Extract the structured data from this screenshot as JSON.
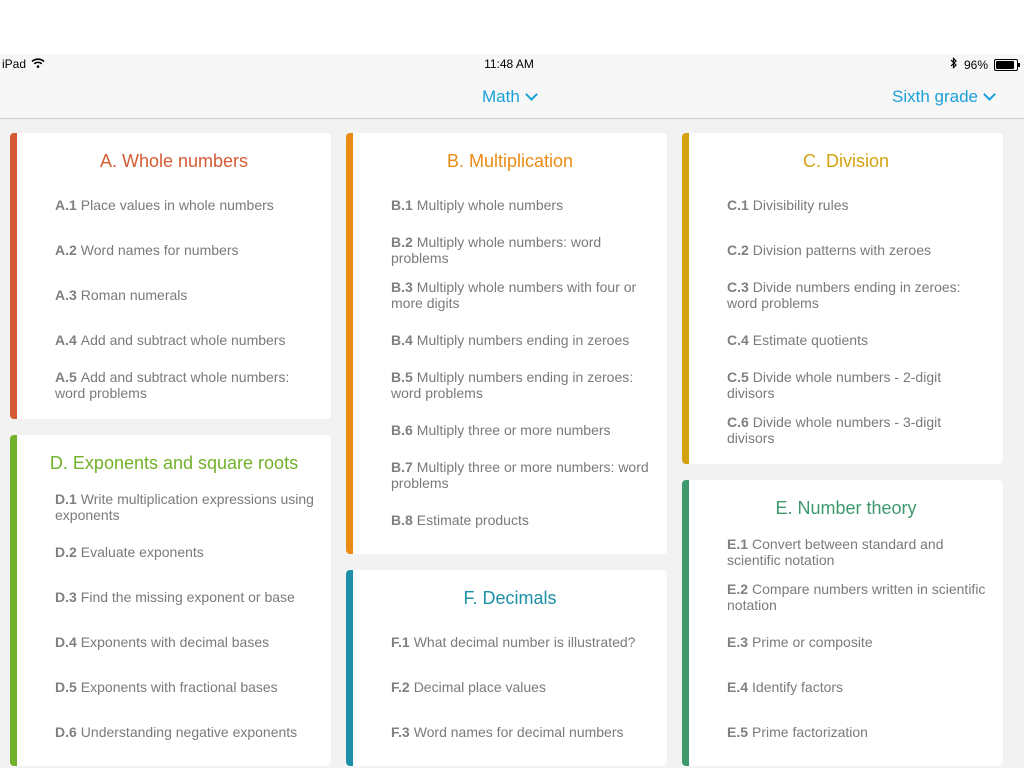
{
  "status": {
    "device": "iPad",
    "time": "11:48 AM",
    "battery": "96%"
  },
  "nav": {
    "subject": "Math",
    "grade": "Sixth grade"
  },
  "colors": {
    "A": "#d45b33",
    "B": "#ea8c14",
    "C": "#d4a20f",
    "D": "#72b12a",
    "E": "#3e9a6d",
    "F": "#1d8fa8"
  },
  "cards": {
    "A": {
      "title": "A.  Whole numbers",
      "skills": [
        {
          "code": "A.1",
          "name": "Place values in whole numbers"
        },
        {
          "code": "A.2",
          "name": "Word names for numbers"
        },
        {
          "code": "A.3",
          "name": "Roman numerals"
        },
        {
          "code": "A.4",
          "name": "Add and subtract whole numbers"
        },
        {
          "code": "A.5",
          "name": "Add and subtract whole numbers: word problems"
        }
      ]
    },
    "D": {
      "title": "D.  Exponents and square roots",
      "skills": [
        {
          "code": "D.1",
          "name": "Write multiplication expressions using exponents"
        },
        {
          "code": "D.2",
          "name": "Evaluate exponents"
        },
        {
          "code": "D.3",
          "name": "Find the missing exponent or base"
        },
        {
          "code": "D.4",
          "name": "Exponents with decimal bases"
        },
        {
          "code": "D.5",
          "name": "Exponents with fractional bases"
        },
        {
          "code": "D.6",
          "name": "Understanding negative exponents"
        }
      ]
    },
    "B": {
      "title": "B.  Multiplication",
      "skills": [
        {
          "code": "B.1",
          "name": "Multiply whole numbers"
        },
        {
          "code": "B.2",
          "name": "Multiply whole numbers: word problems"
        },
        {
          "code": "B.3",
          "name": "Multiply whole numbers with four or more digits"
        },
        {
          "code": "B.4",
          "name": "Multiply numbers ending in zeroes"
        },
        {
          "code": "B.5",
          "name": "Multiply numbers ending in zeroes: word problems"
        },
        {
          "code": "B.6",
          "name": "Multiply three or more numbers"
        },
        {
          "code": "B.7",
          "name": "Multiply three or more numbers: word problems"
        },
        {
          "code": "B.8",
          "name": "Estimate products"
        }
      ]
    },
    "F": {
      "title": "F.  Decimals",
      "skills": [
        {
          "code": "F.1",
          "name": "What decimal number is illustrated?"
        },
        {
          "code": "F.2",
          "name": "Decimal place values"
        },
        {
          "code": "F.3",
          "name": "Word names for decimal numbers"
        }
      ]
    },
    "C": {
      "title": "C.  Division",
      "skills": [
        {
          "code": "C.1",
          "name": "Divisibility rules"
        },
        {
          "code": "C.2",
          "name": "Division patterns with zeroes"
        },
        {
          "code": "C.3",
          "name": "Divide numbers ending in zeroes: word problems"
        },
        {
          "code": "C.4",
          "name": "Estimate quotients"
        },
        {
          "code": "C.5",
          "name": "Divide whole numbers - 2-digit divisors"
        },
        {
          "code": "C.6",
          "name": "Divide whole numbers - 3-digit divisors"
        }
      ]
    },
    "E": {
      "title": "E.  Number theory",
      "skills": [
        {
          "code": "E.1",
          "name": "Convert between standard and scientific notation"
        },
        {
          "code": "E.2",
          "name": "Compare numbers written in scientific notation"
        },
        {
          "code": "E.3",
          "name": "Prime or composite"
        },
        {
          "code": "E.4",
          "name": "Identify factors"
        },
        {
          "code": "E.5",
          "name": "Prime factorization"
        }
      ]
    }
  }
}
